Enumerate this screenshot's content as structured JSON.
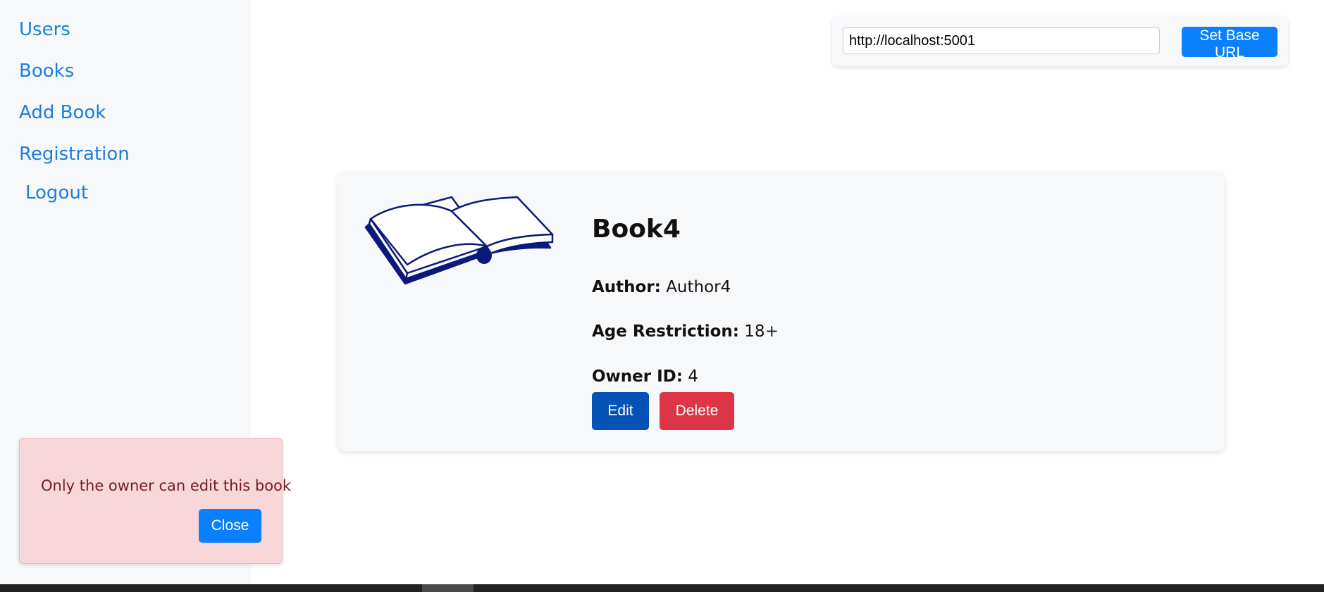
{
  "sidebar": {
    "items": [
      {
        "label": "Users"
      },
      {
        "label": "Books"
      },
      {
        "label": "Add Book"
      },
      {
        "label": "Registration"
      },
      {
        "label": "Logout"
      }
    ]
  },
  "base_url": {
    "value": "http://localhost:5001",
    "button_label": "Set Base URL"
  },
  "book": {
    "title": "Book4",
    "author_label": "Author:",
    "author": "Author4",
    "age_label": "Age Restriction:",
    "age": "18+",
    "owner_label": "Owner ID:",
    "owner_id": "4",
    "image_icon": "open-book-icon",
    "edit_label": "Edit",
    "delete_label": "Delete"
  },
  "alert": {
    "message": "Only the owner can edit this book",
    "close_label": "Close"
  },
  "colors": {
    "link": "#1a7fe0",
    "primary": "#0a80ff",
    "edit": "#0653b6",
    "danger": "#dc3545",
    "alert_bg": "#f8d7da",
    "alert_text": "#721c24",
    "book_ink": "#0b1a7a"
  }
}
